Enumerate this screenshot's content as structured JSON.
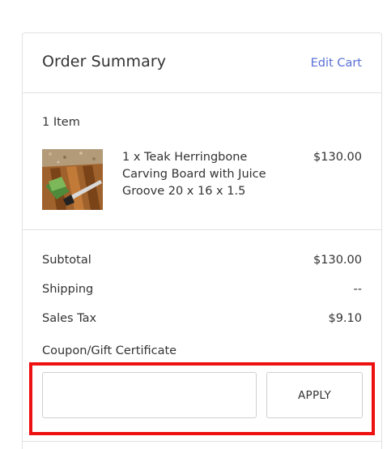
{
  "header": {
    "title": "Order Summary",
    "edit_cart_label": "Edit Cart"
  },
  "items": {
    "count_label": "1 Item",
    "list": [
      {
        "name": "1 x Teak Herringbone Carving Board with Juice Groove 20 x 16 x 1.5",
        "price": "$130.00",
        "thumbnail_icon": "cutting-board-thumbnail"
      }
    ]
  },
  "totals": {
    "subtotal_label": "Subtotal",
    "subtotal_value": "$130.00",
    "shipping_label": "Shipping",
    "shipping_value": "--",
    "tax_label": "Sales Tax",
    "tax_value": "$9.10"
  },
  "coupon": {
    "label": "Coupon/Gift Certificate",
    "input_value": "",
    "apply_label": "APPLY"
  },
  "colors": {
    "link": "#5a6fd6",
    "border": "#e2e2e2",
    "highlight": "#ee1111"
  }
}
